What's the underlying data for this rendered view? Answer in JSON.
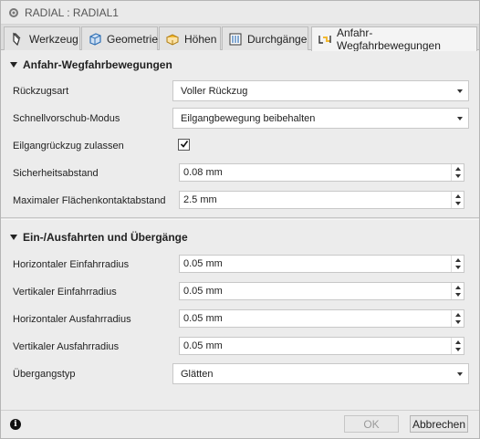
{
  "window": {
    "title": "RADIAL : RADIAL1"
  },
  "tabs": [
    {
      "label": "Werkzeug",
      "icon": "tool-icon"
    },
    {
      "label": "Geometrie",
      "icon": "geometry-icon"
    },
    {
      "label": "Höhen",
      "icon": "heights-icon"
    },
    {
      "label": "Durchgänge",
      "icon": "passes-icon"
    },
    {
      "label": "Anfahr-Wegfahrbewegungen",
      "icon": "linking-icon",
      "active": true
    }
  ],
  "section1": {
    "header": "Anfahr-Wegfahrbewegungen",
    "retract_type": {
      "label": "Rückzugsart",
      "value": "Voller Rückzug"
    },
    "rapid_mode": {
      "label": "Schnellvorschub-Modus",
      "value": "Eilgangbewegung beibehalten"
    },
    "allow_rapid_retract": {
      "label": "Eilgangrückzug zulassen",
      "checked": true
    },
    "safe_distance": {
      "label": "Sicherheitsabstand",
      "value": "0.08 mm"
    },
    "max_contact_distance": {
      "label": "Maximaler Flächenkontaktabstand",
      "value": "2.5 mm"
    }
  },
  "section2": {
    "header": "Ein-/Ausfahrten und Übergänge",
    "h_entry_radius": {
      "label": "Horizontaler Einfahrradius",
      "value": "0.05 mm"
    },
    "v_entry_radius": {
      "label": "Vertikaler Einfahrradius",
      "value": "0.05 mm"
    },
    "h_exit_radius": {
      "label": "Horizontaler Ausfahrradius",
      "value": "0.05 mm"
    },
    "v_exit_radius": {
      "label": "Vertikaler Ausfahrradius",
      "value": "0.05 mm"
    },
    "transition_type": {
      "label": "Übergangstyp",
      "value": "Glätten"
    }
  },
  "footer": {
    "ok_label": "OK",
    "cancel_label": "Abbrechen"
  },
  "colors": {
    "accent": "#2f6fb4",
    "icon_yellow": "#f2b830"
  }
}
